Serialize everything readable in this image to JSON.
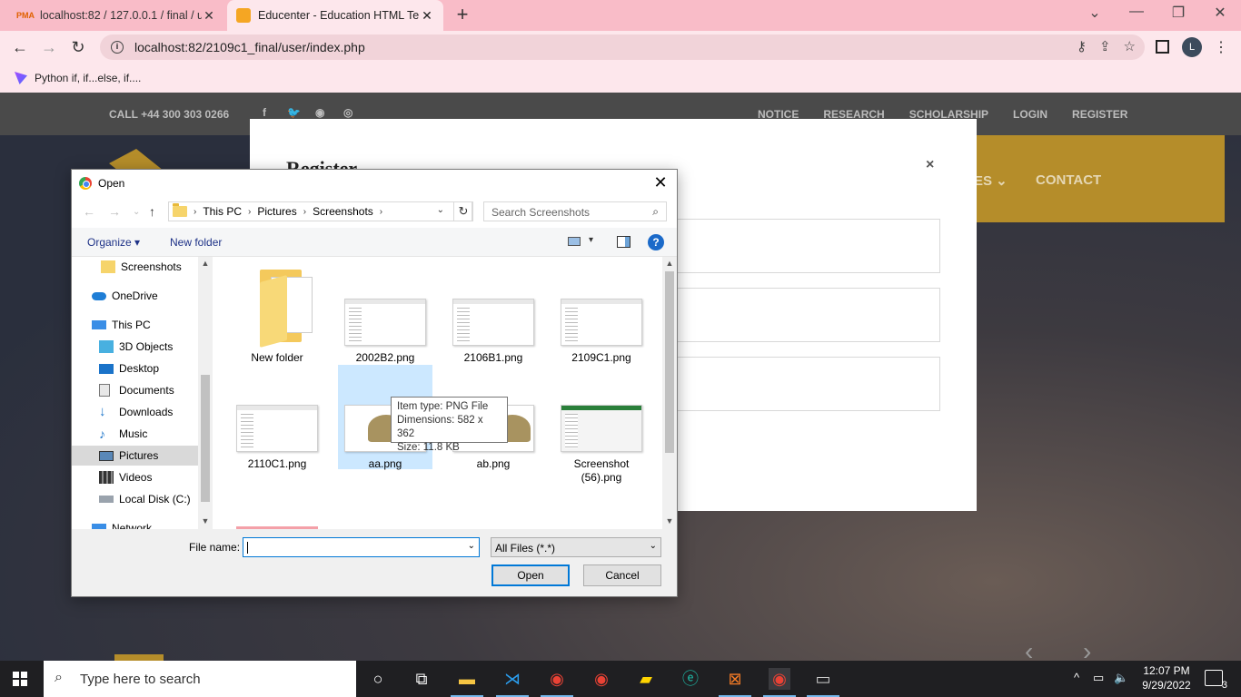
{
  "browser": {
    "tabs": [
      {
        "label": "localhost:82 / 127.0.0.1 / final / u",
        "favicon": "pma-icon"
      },
      {
        "label": "Educenter - Education HTML Tem",
        "favicon": "educenter-icon"
      }
    ],
    "url": "localhost:82/2109c1_final/user/index.php",
    "profile_initial": "L",
    "bookmark": "Python if, if...else, if...."
  },
  "page": {
    "call": "CALL +44 300 303 0266",
    "topnav": [
      "NOTICE",
      "RESEARCH",
      "SCHOLARSHIP",
      "LOGIN",
      "REGISTER"
    ],
    "mainnav_partial": "ES ⌄",
    "mainnav_contact": "CONTACT",
    "modal_title": "Register",
    "modal_close": "×"
  },
  "dialog": {
    "title": "Open",
    "breadcrumb": [
      "This PC",
      "Pictures",
      "Screenshots"
    ],
    "search_placeholder": "Search Screenshots",
    "organize": "Organize ▾",
    "new_folder": "New folder",
    "nav_items": [
      {
        "label": "Screenshots",
        "icon": "folder-icon"
      },
      {
        "label": "OneDrive",
        "icon": "cloud-icon"
      },
      {
        "label": "This PC",
        "icon": "pc-icon"
      },
      {
        "label": "3D Objects",
        "icon": "cube-icon"
      },
      {
        "label": "Desktop",
        "icon": "desktop-icon"
      },
      {
        "label": "Documents",
        "icon": "documents-icon"
      },
      {
        "label": "Downloads",
        "icon": "download-icon"
      },
      {
        "label": "Music",
        "icon": "music-icon"
      },
      {
        "label": "Pictures",
        "icon": "pictures-icon"
      },
      {
        "label": "Videos",
        "icon": "video-icon"
      },
      {
        "label": "Local Disk (C:)",
        "icon": "disk-icon"
      },
      {
        "label": "Network",
        "icon": "network-icon"
      }
    ],
    "files": [
      {
        "label": "New folder",
        "type": "folder"
      },
      {
        "label": "2002B2.png",
        "type": "png"
      },
      {
        "label": "2106B1.png",
        "type": "png"
      },
      {
        "label": "2109C1.png",
        "type": "png"
      },
      {
        "label": "2110C1.png",
        "type": "png"
      },
      {
        "label": "aa.png",
        "type": "png"
      },
      {
        "label": "ab.png",
        "type": "png"
      },
      {
        "label": "Screenshot (56).png",
        "type": "png"
      }
    ],
    "tooltip": {
      "type": "Item type: PNG File",
      "dimensions": "Dimensions: 582 x 362",
      "size": "Size: 11.8 KB"
    },
    "filename_label": "File name:",
    "filename_value": "",
    "filter": "All Files (*.*)",
    "open_button": "Open",
    "cancel_button": "Cancel"
  },
  "taskbar": {
    "search_placeholder": "Type here to search",
    "time": "12:07 PM",
    "date": "9/29/2022",
    "notifications": "3"
  },
  "colors": {
    "tab_strip": "#f9bcc8",
    "toolbar": "#fde7ec",
    "accent_gold": "#b58d2a",
    "selection": "#cce8ff"
  }
}
